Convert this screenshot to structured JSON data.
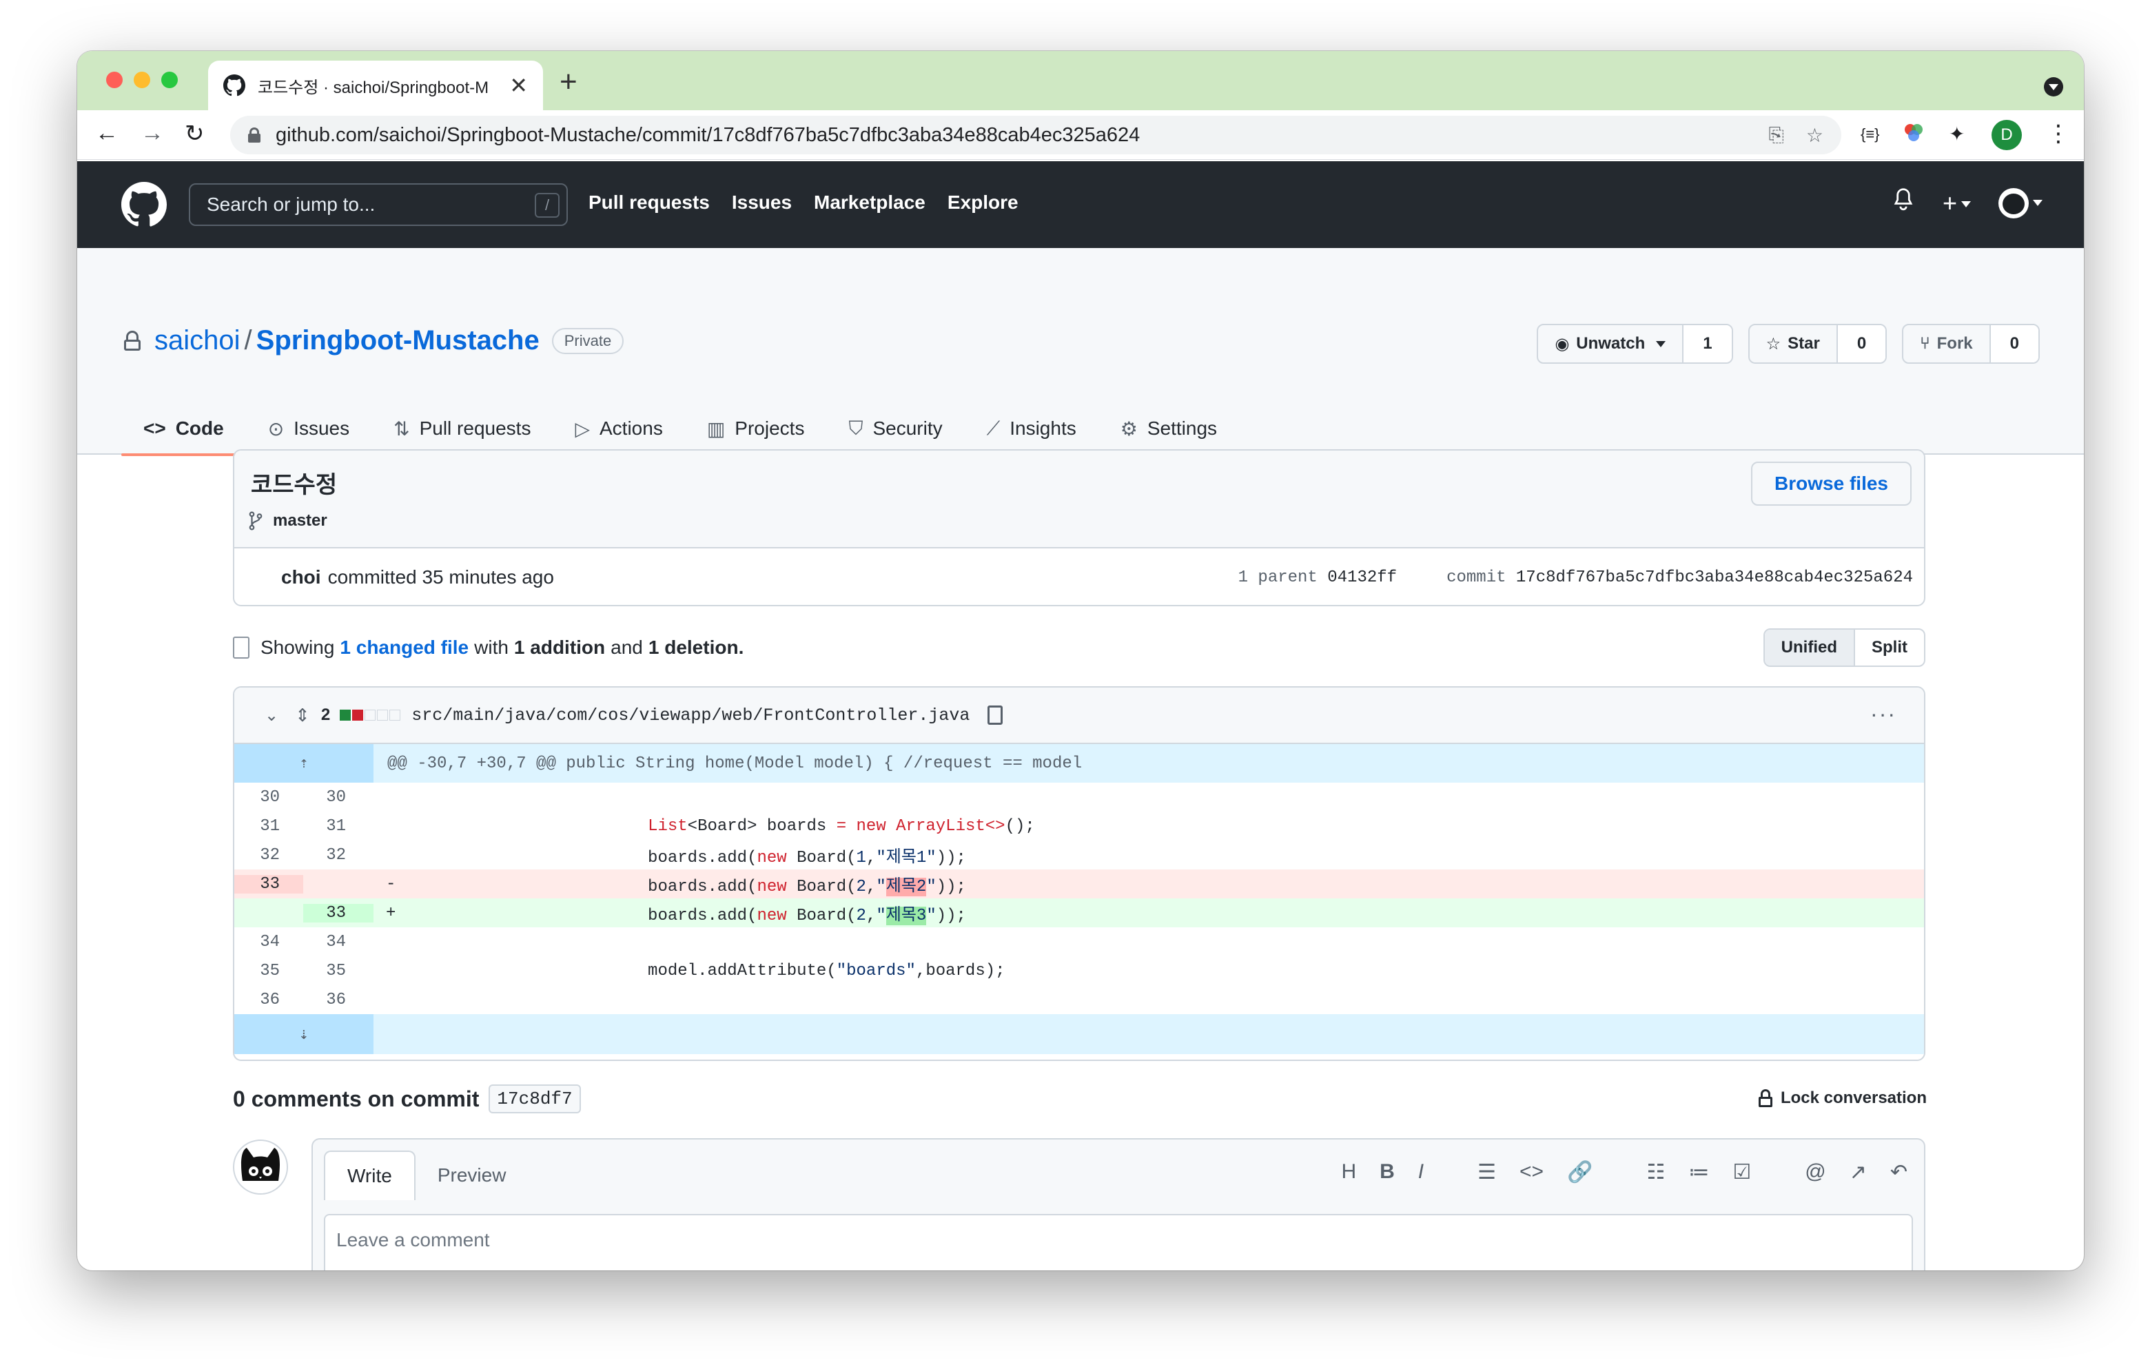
{
  "browser": {
    "tab_title": "코드수정 · saichoi/Springboot-M",
    "tab_close": "✕",
    "new_tab": "+",
    "url": "github.com/saichoi/Springboot-Mustache/commit/17c8df767ba5c7dfbc3aba34e88cab4ec325a624",
    "profile_initial": "D",
    "back": "←",
    "forward": "→",
    "reload": "↻",
    "menu": "⋮"
  },
  "github_header": {
    "search_placeholder": "Search or jump to...",
    "search_key": "/",
    "nav": [
      "Pull requests",
      "Issues",
      "Marketplace",
      "Explore"
    ],
    "bell": "🔔",
    "plus": "+"
  },
  "repo": {
    "owner": "saichoi",
    "separator": "/",
    "name": "Springboot-Mustache",
    "visibility": "Private",
    "watch": {
      "label": "Unwatch",
      "count": "1"
    },
    "star": {
      "label": "Star",
      "count": "0"
    },
    "fork": {
      "label": "Fork",
      "count": "0"
    },
    "tabs": [
      {
        "label": "Code",
        "icon": "<>"
      },
      {
        "label": "Issues",
        "icon": "⊙"
      },
      {
        "label": "Pull requests",
        "icon": "⇅"
      },
      {
        "label": "Actions",
        "icon": "▷"
      },
      {
        "label": "Projects",
        "icon": "▥"
      },
      {
        "label": "Security",
        "icon": "⛉"
      },
      {
        "label": "Insights",
        "icon": "⟋"
      },
      {
        "label": "Settings",
        "icon": "⚙"
      }
    ]
  },
  "commit": {
    "message": "코드수정",
    "branch": "master",
    "browse_files": "Browse files",
    "author": "choi",
    "committed_text": "committed 35 minutes ago",
    "parent_label": "1 parent",
    "parent_sha": "04132ff",
    "commit_label": "commit",
    "commit_sha": "17c8df767ba5c7dfbc3aba34e88cab4ec325a624"
  },
  "diff_summary": {
    "showing": "Showing",
    "changed_files": "1 changed file",
    "with": "with",
    "additions": "1 addition",
    "and": "and",
    "deletions": "1 deletion.",
    "unified": "Unified",
    "split": "Split"
  },
  "file": {
    "changes": "2",
    "path": "src/main/java/com/cos/viewapp/web/FrontController.java",
    "more": "···",
    "hunk_header": "@@ -30,7 +30,7 @@ public String home(Model model) { //request == model"
  },
  "comments": {
    "title": "0 comments on commit",
    "short_sha": "17c8df7",
    "lock": "Lock conversation",
    "write_tab": "Write",
    "preview_tab": "Preview",
    "placeholder": "Leave a comment",
    "tools": [
      "H",
      "B",
      "I",
      "☰",
      "<>",
      "🔗",
      "☷",
      "≔",
      "☑",
      "@",
      "↗",
      "↶"
    ]
  },
  "colors": {
    "header_bg": "#24292f",
    "link": "#0969da",
    "tab_underline": "#fd8c73",
    "add_bg": "#e6ffec",
    "del_bg": "#ffebe9",
    "hunk_bg": "#ddf4ff"
  }
}
